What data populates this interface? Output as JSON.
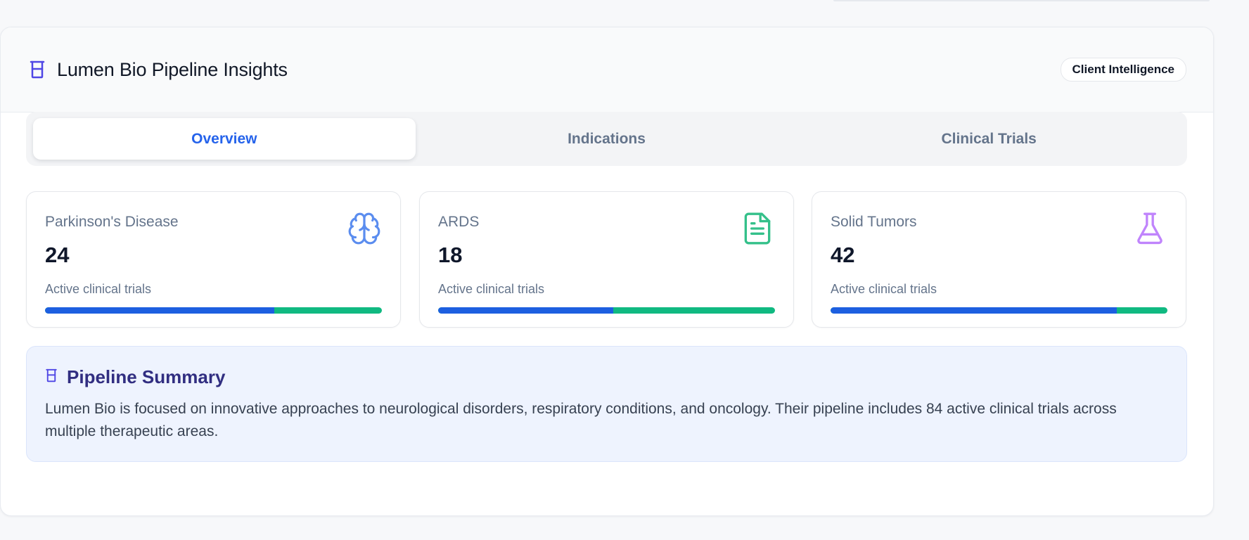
{
  "header": {
    "title": "Lumen Bio Pipeline Insights",
    "badge": "Client Intelligence",
    "icon": "beaker-icon"
  },
  "tabs": [
    {
      "label": "Overview",
      "active": true
    },
    {
      "label": "Indications",
      "active": false
    },
    {
      "label": "Clinical Trials",
      "active": false
    }
  ],
  "stats": [
    {
      "label": "Parkinson's Disease",
      "value": "24",
      "sub": "Active clinical trials",
      "icon": "brain-icon",
      "icon_color": "#5b8def",
      "progress": 0.68
    },
    {
      "label": "ARDS",
      "value": "18",
      "sub": "Active clinical trials",
      "icon": "document-icon",
      "icon_color": "#34c08a",
      "progress": 0.52
    },
    {
      "label": "Solid Tumors",
      "value": "42",
      "sub": "Active clinical trials",
      "icon": "flask-icon",
      "icon_color": "#c084fc",
      "progress": 0.85
    }
  ],
  "summary": {
    "title": "Pipeline Summary",
    "text": "Lumen Bio is focused on innovative approaches to neurological disorders, respiratory conditions, and oncology. Their pipeline includes 84 active clinical trials across multiple therapeutic areas."
  },
  "colors": {
    "accent": "#2563eb",
    "bar_primary": "#1d5fe0",
    "bar_secondary": "#10b981",
    "summary_title": "#312e81"
  }
}
